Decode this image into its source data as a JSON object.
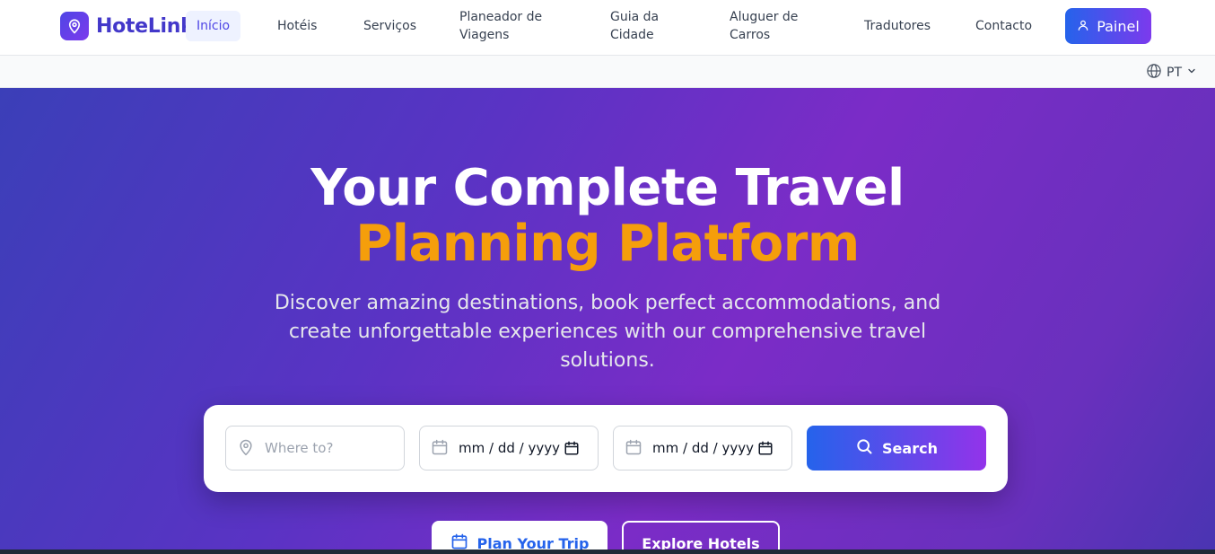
{
  "brand": {
    "name": "HoteLink"
  },
  "nav": {
    "items": [
      {
        "label": "Início",
        "active": true
      },
      {
        "label": "Hotéis"
      },
      {
        "label": "Serviços"
      },
      {
        "label": "Planeador de Viagens"
      },
      {
        "label": "Guia da Cidade"
      },
      {
        "label": "Aluguer de Carros"
      },
      {
        "label": "Tradutores"
      },
      {
        "label": "Contacto"
      }
    ],
    "dashboard_label": "Painel"
  },
  "language": {
    "code": "PT"
  },
  "hero": {
    "title_line1": "Your Complete Travel",
    "title_line2": "Planning Platform",
    "subtitle": "Discover amazing destinations, book perfect accommodations, and create unforgettable experiences with our comprehensive travel solutions."
  },
  "search": {
    "destination_placeholder": "Where to?",
    "checkin_value": "mm / dd / yyyy",
    "checkout_value": "mm / dd / yyyy",
    "button_label": "Search"
  },
  "cta": {
    "plan_label": "Plan Your Trip",
    "explore_label": "Explore Hotels"
  },
  "colors": {
    "accent": "#4f46e5",
    "highlight": "#f59e0b",
    "button_gradient_start": "#2563eb",
    "button_gradient_end": "#9333ea"
  },
  "icons": [
    "map-pin-icon",
    "user-icon",
    "globe-icon",
    "chevron-down-icon",
    "calendar-icon",
    "search-icon"
  ]
}
